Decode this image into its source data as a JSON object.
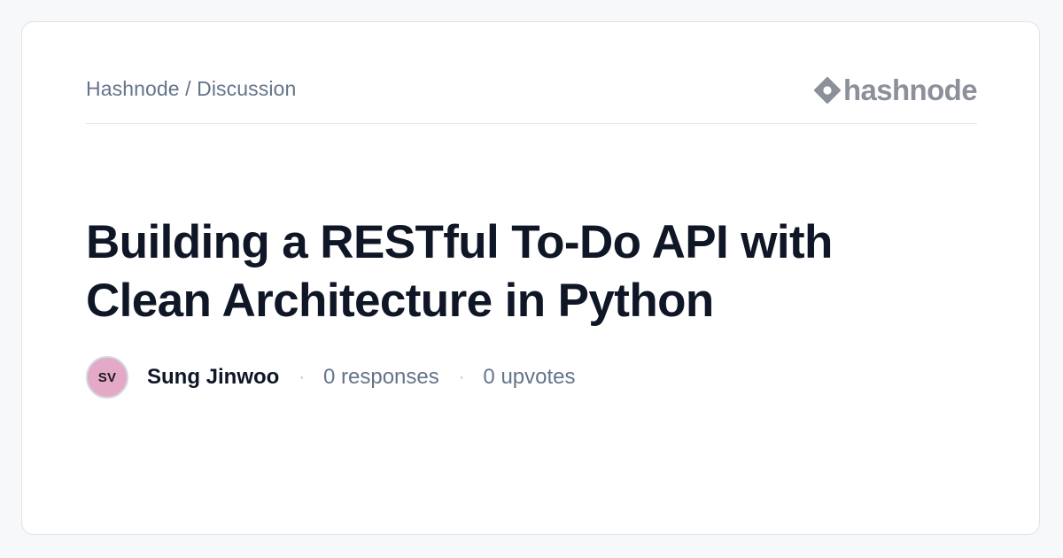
{
  "breadcrumb": "Hashnode / Discussion",
  "brand": {
    "name": "hashnode",
    "logo_icon": "hashnode-diamond-icon",
    "logo_color": "#8b9099"
  },
  "post": {
    "title_line_1": "Building a RESTful To-Do API with",
    "title_line_2": "Clean Architecture  in Python"
  },
  "author": {
    "initials": "SV",
    "name": "Sung Jinwoo",
    "avatar_color": "#e4a9c6"
  },
  "stats": {
    "separator": "·",
    "responses": "0 responses",
    "upvotes": "0 upvotes"
  }
}
